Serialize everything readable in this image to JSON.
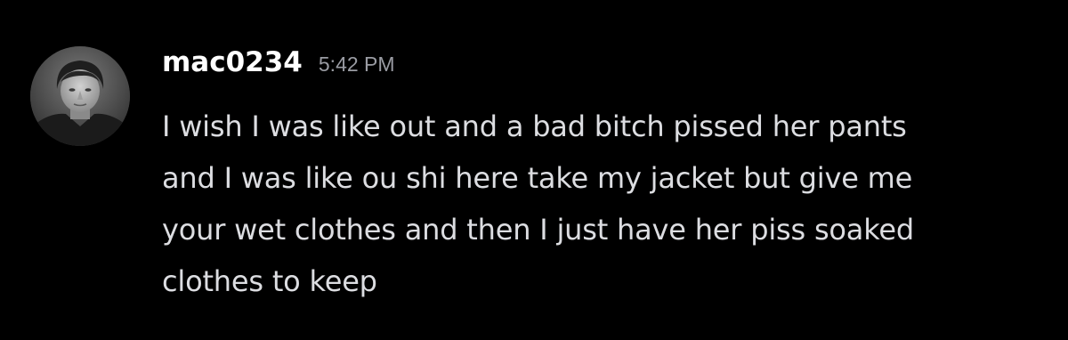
{
  "message": {
    "author": "mac0234",
    "timestamp": "5:42 PM",
    "lines": [
      "I wish I was like out and a bad bitch pissed her pants",
      "and I was like ou shi here take my jacket but give me",
      "your wet clothes and then I just have her piss soaked",
      "clothes to keep"
    ]
  },
  "colors": {
    "background": "#000000",
    "author": "#ffffff",
    "timestamp": "#9a9ca3",
    "text": "#dcdde1"
  }
}
